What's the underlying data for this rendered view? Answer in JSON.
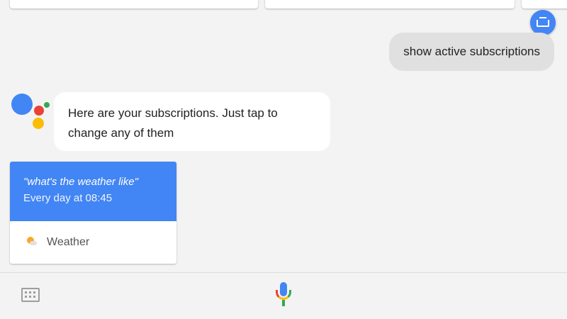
{
  "conversation": {
    "user_query": "show active subscriptions",
    "assistant_reply": "Here are your subscriptions. Just tap to change any of them"
  },
  "subscription_card": {
    "query": "\"what's the weather like\"",
    "schedule": "Every day at 08:45",
    "topic": "Weather",
    "header_color": "#4285f4"
  },
  "icons": {
    "assistant_logo": "google-assistant-dots-icon",
    "keyboard_fab": "keyboard-icon",
    "keyboard_toggle": "keyboard-icon",
    "microphone": "microphone-icon",
    "weather": "sun-cloud-icon"
  },
  "colors": {
    "blue": "#4285f4",
    "red": "#ea4335",
    "yellow": "#fbbc05",
    "green": "#34a853"
  }
}
